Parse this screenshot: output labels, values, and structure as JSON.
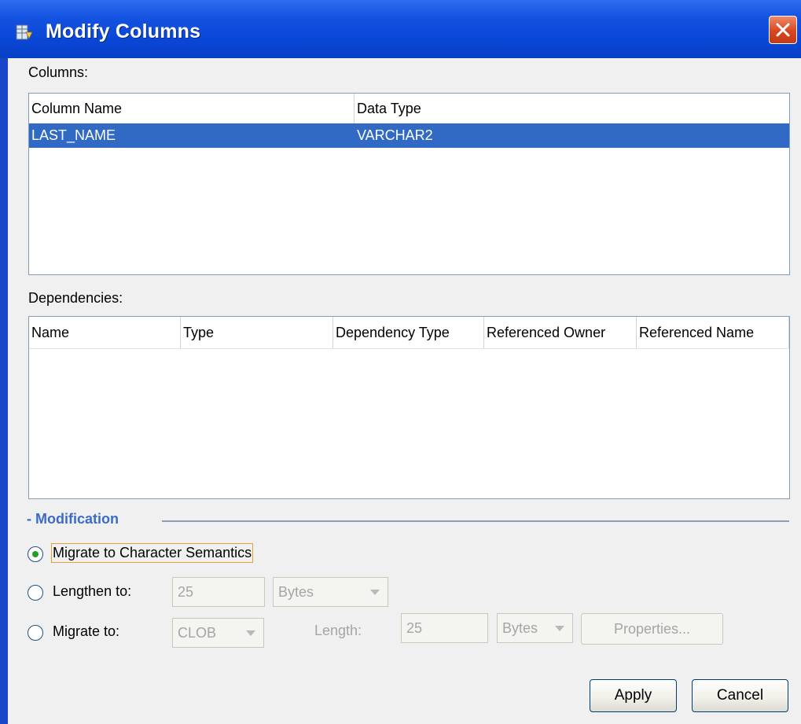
{
  "window": {
    "title": "Modify Columns"
  },
  "columns_section": {
    "label": "Columns:",
    "headers": [
      "Column Name",
      "Data Type"
    ],
    "rows": [
      {
        "column_name": "LAST_NAME",
        "data_type": "VARCHAR2",
        "selected": true
      }
    ]
  },
  "dependencies_section": {
    "label": "Dependencies:",
    "headers": [
      "Name",
      "Type",
      "Dependency Type",
      "Referenced Owner",
      "Referenced Name"
    ],
    "rows": []
  },
  "modification": {
    "title": "- Modification",
    "options": [
      {
        "label": "Migrate to Character Semantics",
        "checked": true
      },
      {
        "label": "Lengthen to:",
        "checked": false
      },
      {
        "label": "Migrate to:",
        "checked": false
      }
    ],
    "lengthen_value": "25",
    "lengthen_unit": "Bytes",
    "migrate_type": "CLOB",
    "length_label": "Length:",
    "migrate_length": "25",
    "migrate_unit": "Bytes",
    "properties_label": "Properties..."
  },
  "buttons": {
    "apply": "Apply",
    "cancel": "Cancel"
  },
  "colors": {
    "titlebar": "#0a46d6",
    "selection": "#316ac5",
    "section_title": "#3c6ac8",
    "radio_dot": "#21a121"
  }
}
